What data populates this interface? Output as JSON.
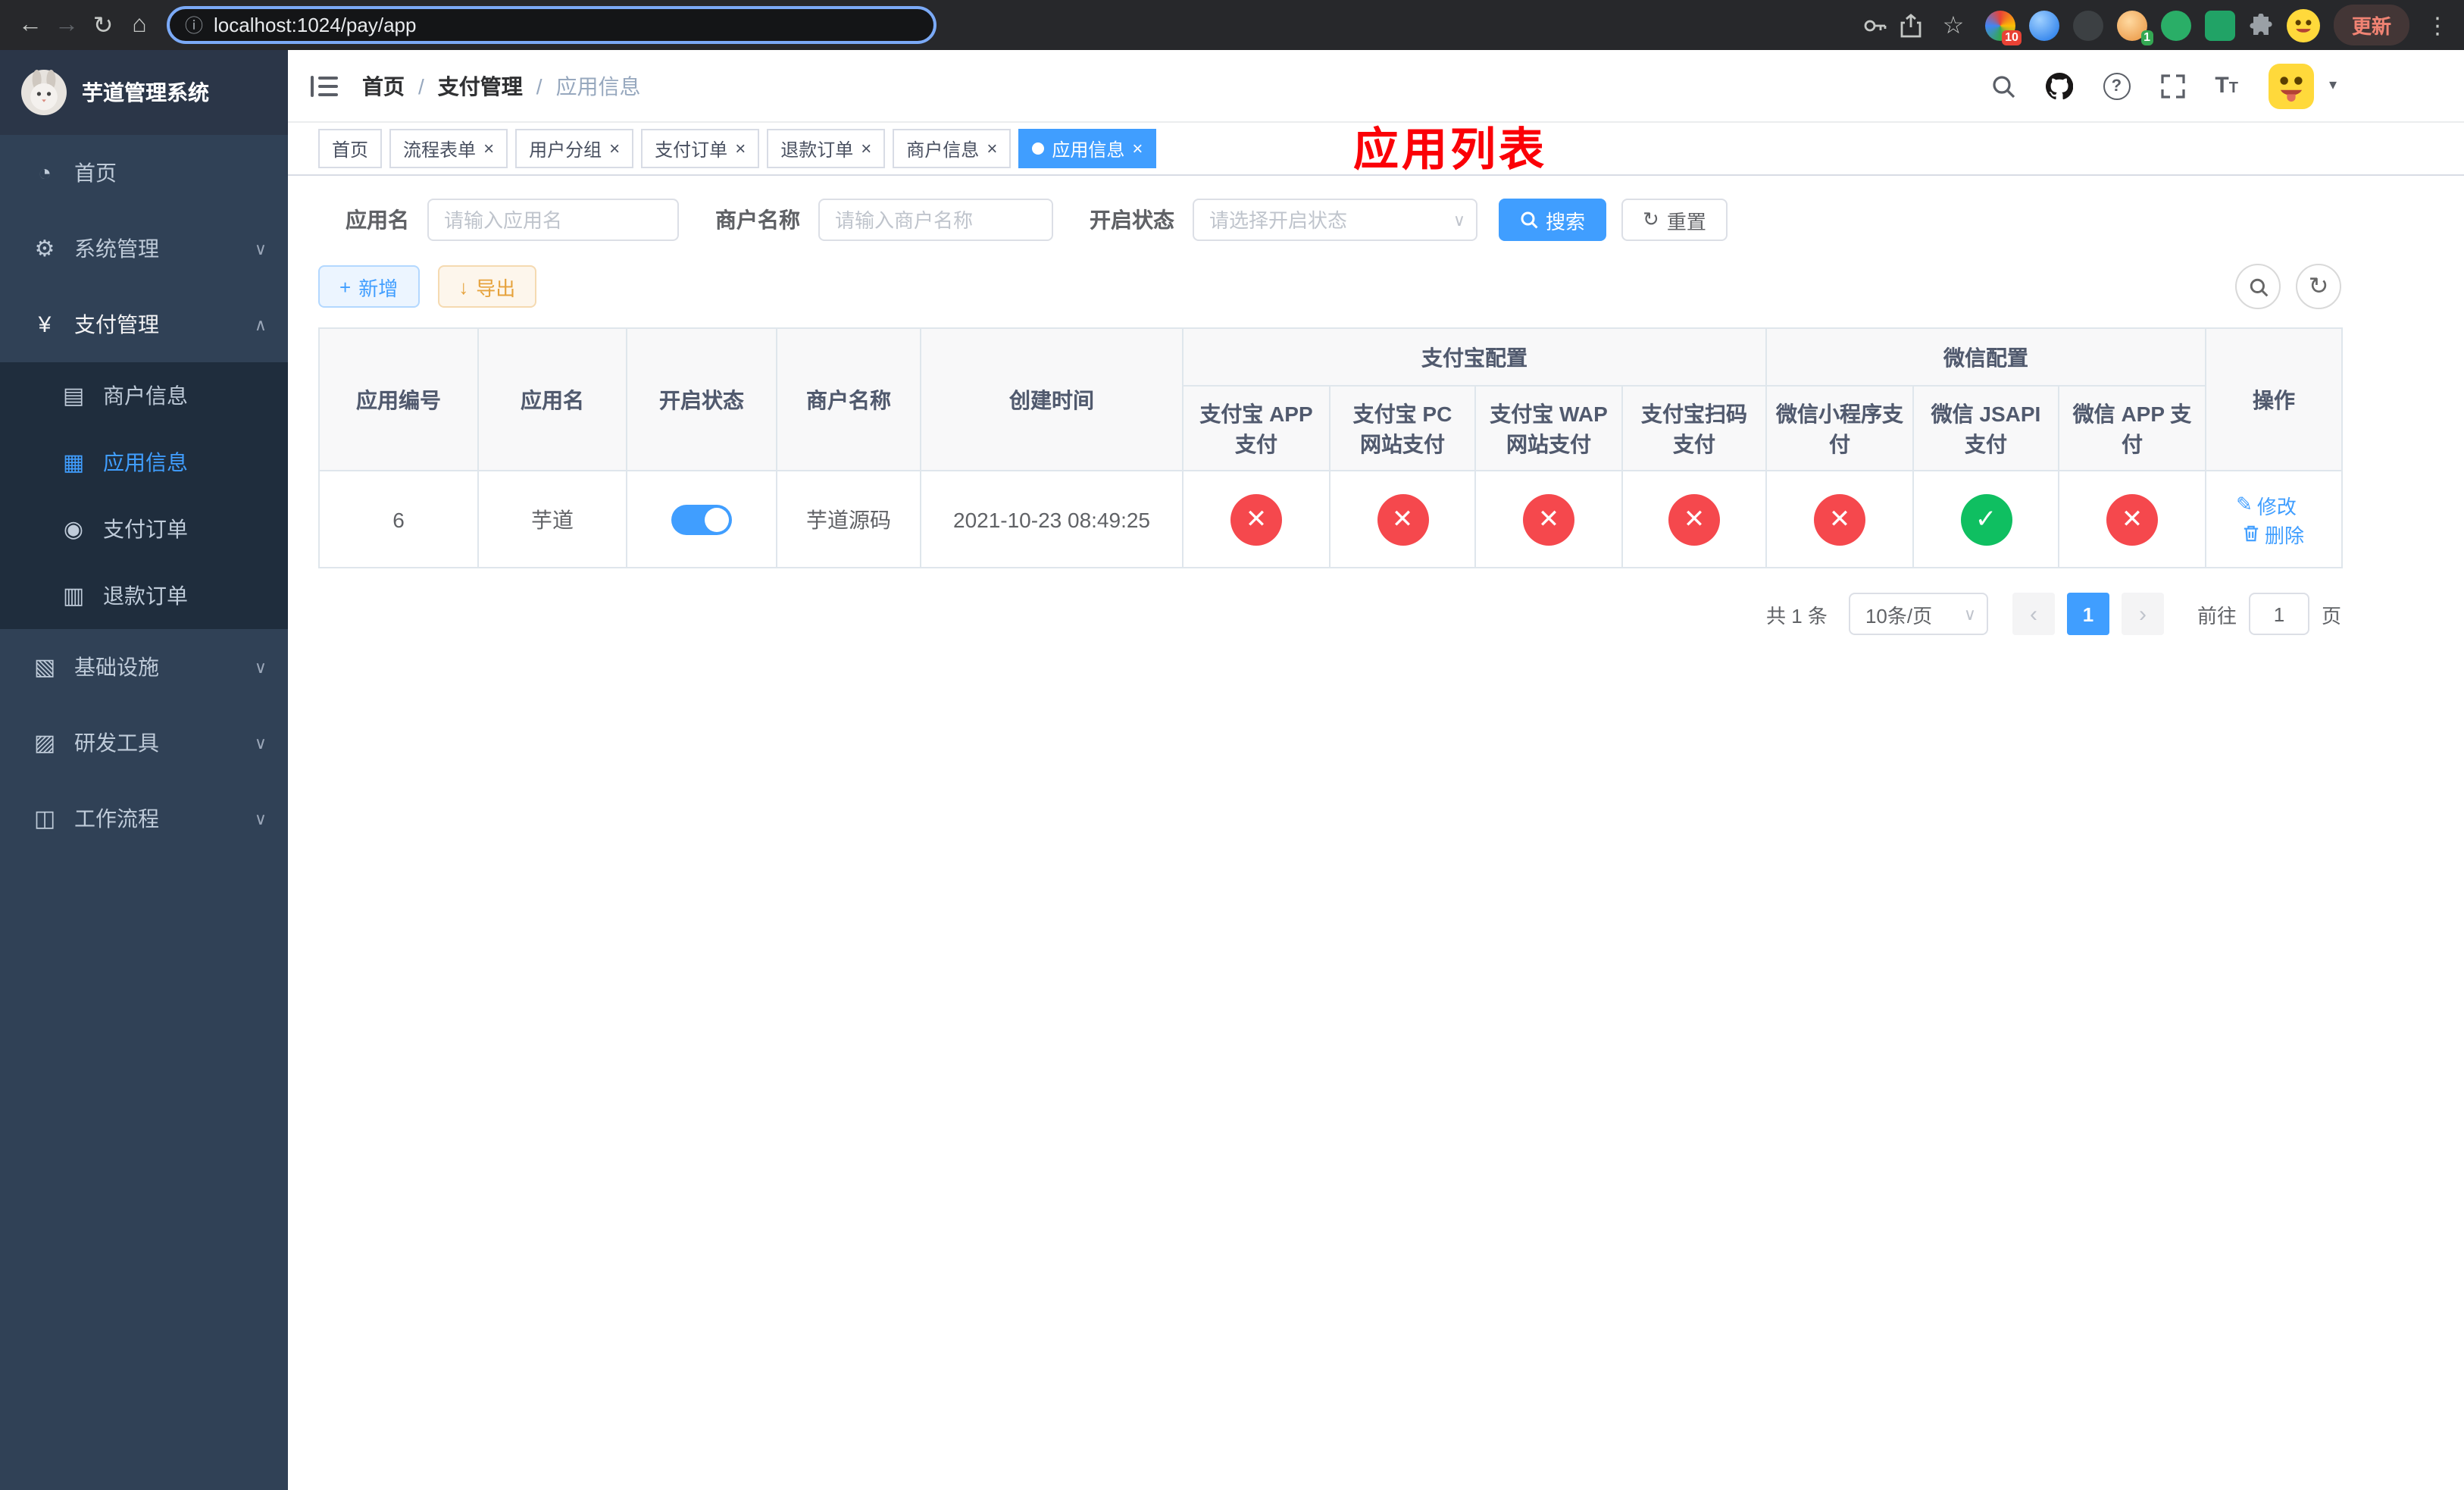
{
  "colors": {
    "accent": "#409eff",
    "danger": "#f5484d",
    "success": "#0fbf61",
    "warning": "#e6a23c",
    "sidebar_bg": "#304156",
    "submenu_bg": "#1f2d3d",
    "tag_active": "#409eff",
    "overlay_red": "#fb0007"
  },
  "icons": {
    "back": "←",
    "forward": "→",
    "reload": "↻",
    "home": "⌂",
    "info": "ⓘ",
    "star": "☆",
    "menu_dots": "⋮",
    "dashboard": "◔",
    "system": "⚙",
    "pay": "¥",
    "merchant": "▤",
    "app": "▦",
    "order": "◉",
    "refund": "▥",
    "infra": "▧",
    "devtool": "▨",
    "workflow": "◫",
    "chevron_down": "∨",
    "chevron_up": "∧",
    "caret_down": "▾",
    "close": "×",
    "check": "✓",
    "cross": "✕",
    "plus": "+",
    "download": "↓",
    "refresh": "↻",
    "edit": "✎",
    "question": "?",
    "font_size": "T"
  },
  "browser": {
    "url": "localhost:1024/pay/app",
    "update_label": "更新",
    "ext_badge_10": "10",
    "ext_badge_1": "1"
  },
  "overlay_title": "应用列表",
  "sidebar": {
    "logo_title": "芋道管理系统",
    "items": [
      {
        "label": "首页"
      },
      {
        "label": "系统管理"
      },
      {
        "label": "支付管理",
        "children": [
          {
            "label": "商户信息"
          },
          {
            "label": "应用信息"
          },
          {
            "label": "支付订单"
          },
          {
            "label": "退款订单"
          }
        ]
      },
      {
        "label": "基础设施"
      },
      {
        "label": "研发工具"
      },
      {
        "label": "工作流程"
      }
    ]
  },
  "breadcrumb": [
    "首页",
    "支付管理",
    "应用信息"
  ],
  "tabs": [
    {
      "label": "首页"
    },
    {
      "label": "流程表单"
    },
    {
      "label": "用户分组"
    },
    {
      "label": "支付订单"
    },
    {
      "label": "退款订单"
    },
    {
      "label": "商户信息"
    },
    {
      "label": "应用信息"
    }
  ],
  "filters": {
    "app_name_label": "应用名",
    "app_name_placeholder": "请输入应用名",
    "merchant_label": "商户名称",
    "merchant_placeholder": "请输入商户名称",
    "status_label": "开启状态",
    "status_placeholder": "请选择开启状态",
    "search_label": "搜索",
    "reset_label": "重置"
  },
  "toolbar": {
    "add_label": "新增",
    "export_label": "导出"
  },
  "table": {
    "col_app_id": "应用编号",
    "col_app_name": "应用名",
    "col_status": "开启状态",
    "col_merchant": "商户名称",
    "col_created": "创建时间",
    "group_alipay": "支付宝配置",
    "group_wechat": "微信配置",
    "col_alipay_app": "支付宝 APP 支付",
    "col_alipay_pc": "支付宝 PC 网站支付",
    "col_alipay_wap": "支付宝 WAP 网站支付",
    "col_alipay_qr": "支付宝扫码支付",
    "col_wx_mini": "微信小程序支付",
    "col_wx_jsapi": "微信 JSAPI 支付",
    "col_wx_app": "微信 APP 支付",
    "col_actions": "操作",
    "row": {
      "id": "6",
      "name": "芋道",
      "status_on": true,
      "merchant": "芋道源码",
      "created": "2021-10-23 08:49:25",
      "statuses": {
        "alipay_app": false,
        "alipay_pc": false,
        "alipay_wap": false,
        "alipay_qr": false,
        "wx_mini": false,
        "wx_jsapi": true,
        "wx_app": false
      },
      "edit_label": "修改",
      "delete_label": "删除"
    }
  },
  "pagination": {
    "total_text": "共 1 条",
    "page_size": "10条/页",
    "prev": "‹",
    "next": "›",
    "current_page": "1",
    "goto_label": "前往",
    "goto_value": "1",
    "page_label": "页"
  }
}
